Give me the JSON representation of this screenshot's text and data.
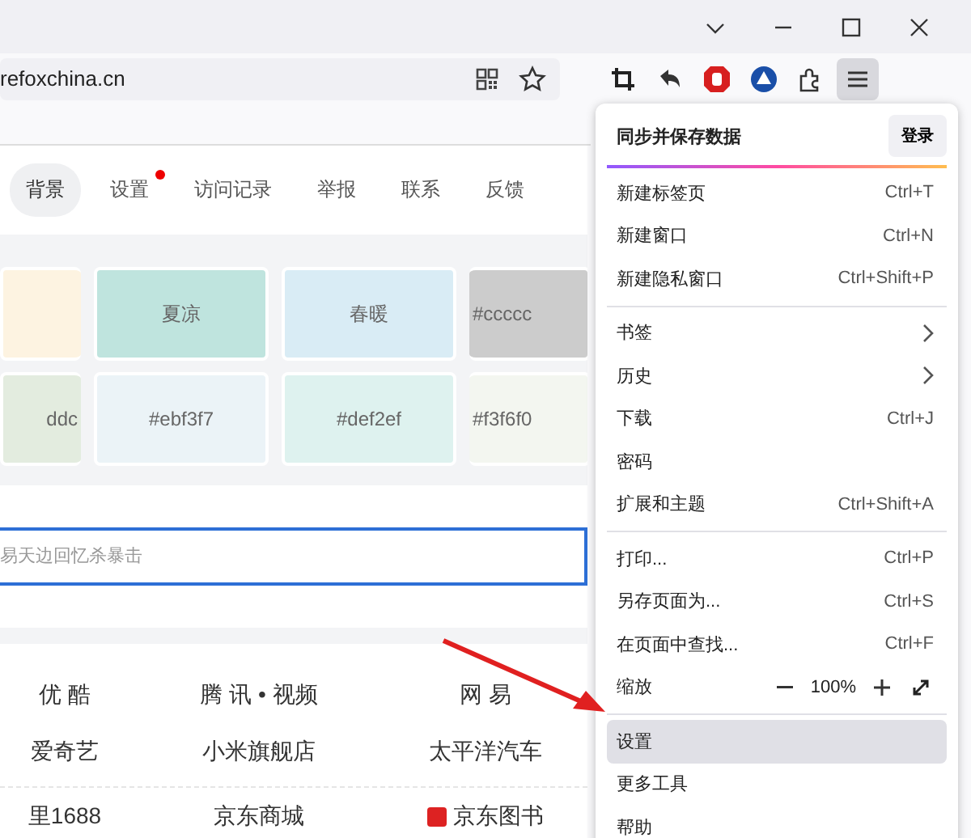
{
  "url_bar": {
    "url": "refoxchina.cn"
  },
  "toolbar": {
    "menu_button_selected": true
  },
  "tabs": [
    {
      "label": "背景",
      "selected": true,
      "dot": false
    },
    {
      "label": "设置",
      "selected": false,
      "dot": true
    },
    {
      "label": "访问记录",
      "selected": false,
      "dot": false
    },
    {
      "label": "举报",
      "selected": false,
      "dot": false
    },
    {
      "label": "联系",
      "selected": false,
      "dot": false
    },
    {
      "label": "反馈",
      "selected": false,
      "dot": false
    }
  ],
  "swatches": [
    [
      {
        "color": "#fdf3e1"
      },
      {
        "label": "夏凉",
        "color": "#bfe4de"
      },
      {
        "label": "春暖",
        "color": "#d9ecf5"
      },
      {
        "label": "#ccccc",
        "color": "#cccccc"
      }
    ],
    [
      {
        "label": "ddc",
        "color": "#e3ecdf"
      },
      {
        "label": "#ebf3f7",
        "color": "#ebf3f7"
      },
      {
        "label": "#def2ef",
        "color": "#def2ef"
      },
      {
        "label": "#f3f6f0",
        "color": "#f3f6f0"
      }
    ]
  ],
  "search": {
    "placeholder": "易天边回忆杀暴击"
  },
  "links": [
    [
      "优 酷",
      "腾 讯 • 视频",
      "网 易"
    ],
    [
      "爱奇艺",
      "小米旗舰店",
      "太平洋汽车"
    ],
    [
      "里1688",
      "京东商城",
      "京东图书"
    ]
  ],
  "menu": {
    "sync_title": "同步并保存数据",
    "sign_in": "登录",
    "items": [
      {
        "kind": "item",
        "label": "新建标签页",
        "shortcut": "Ctrl+T",
        "selected": false
      },
      {
        "kind": "item",
        "label": "新建窗口",
        "shortcut": "Ctrl+N",
        "selected": false
      },
      {
        "kind": "item",
        "label": "新建隐私窗口",
        "shortcut": "Ctrl+Shift+P",
        "selected": false
      },
      {
        "kind": "separator"
      },
      {
        "kind": "submenu",
        "label": "书签",
        "selected": false
      },
      {
        "kind": "submenu",
        "label": "历史",
        "selected": false
      },
      {
        "kind": "item",
        "label": "下载",
        "shortcut": "Ctrl+J",
        "selected": false
      },
      {
        "kind": "item",
        "label": "密码",
        "selected": false
      },
      {
        "kind": "item",
        "label": "扩展和主题",
        "shortcut": "Ctrl+Shift+A",
        "selected": false
      },
      {
        "kind": "separator"
      },
      {
        "kind": "item",
        "label": "打印...",
        "shortcut": "Ctrl+P",
        "selected": false
      },
      {
        "kind": "item",
        "label": "另存页面为...",
        "shortcut": "Ctrl+S",
        "selected": false
      },
      {
        "kind": "item",
        "label": "在页面中查找...",
        "shortcut": "Ctrl+F",
        "selected": false
      },
      {
        "kind": "zoom",
        "label": "缩放",
        "value": "100%",
        "selected": false
      },
      {
        "kind": "separator"
      },
      {
        "kind": "item",
        "label": "设置",
        "selected": true
      },
      {
        "kind": "item",
        "label": "更多工具",
        "selected": false
      },
      {
        "kind": "item",
        "label": "帮助",
        "selected": false
      }
    ]
  }
}
